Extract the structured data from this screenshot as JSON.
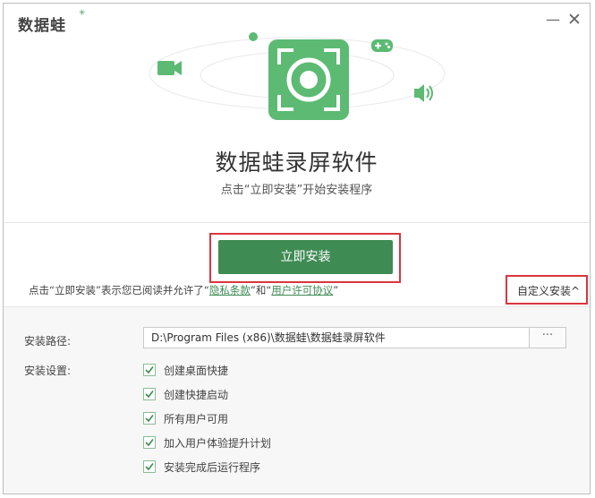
{
  "app": {
    "logo_text": "数据蛙",
    "product_title": "数据蛙录屏软件",
    "subtitle": "点击“立即安装”开始安装程序"
  },
  "window_controls": {
    "minimize": "—",
    "close": "✕"
  },
  "install": {
    "button_label": "立即安装",
    "terms_prefix": "点击“立即安装”表示您已阅读并允许了“",
    "privacy_link": "隐私条款",
    "terms_middle": "”和“",
    "license_link": "用户许可协议",
    "terms_suffix": "”",
    "custom_install_label": "自定义安装",
    "custom_install_chevron": "^"
  },
  "settings": {
    "path_label": "安装路径:",
    "path_value": "D:\\Program Files (x86)\\数据蛙\\数据蛙录屏软件",
    "browse_label": "···",
    "settings_label": "安装设置:",
    "options": [
      {
        "label": "创建桌面快捷",
        "checked": true
      },
      {
        "label": "创建快捷启动",
        "checked": true
      },
      {
        "label": "所有用户可用",
        "checked": true
      },
      {
        "label": "加入用户体验提升计划",
        "checked": true
      },
      {
        "label": "安装完成后运行程序",
        "checked": true
      }
    ]
  },
  "colors": {
    "brand_green": "#3f8b54",
    "light_green": "#5cba73",
    "highlight_red": "#d9363e"
  },
  "icons": [
    "record-icon",
    "video-camera-icon",
    "gamepad-icon",
    "speaker-icon"
  ]
}
